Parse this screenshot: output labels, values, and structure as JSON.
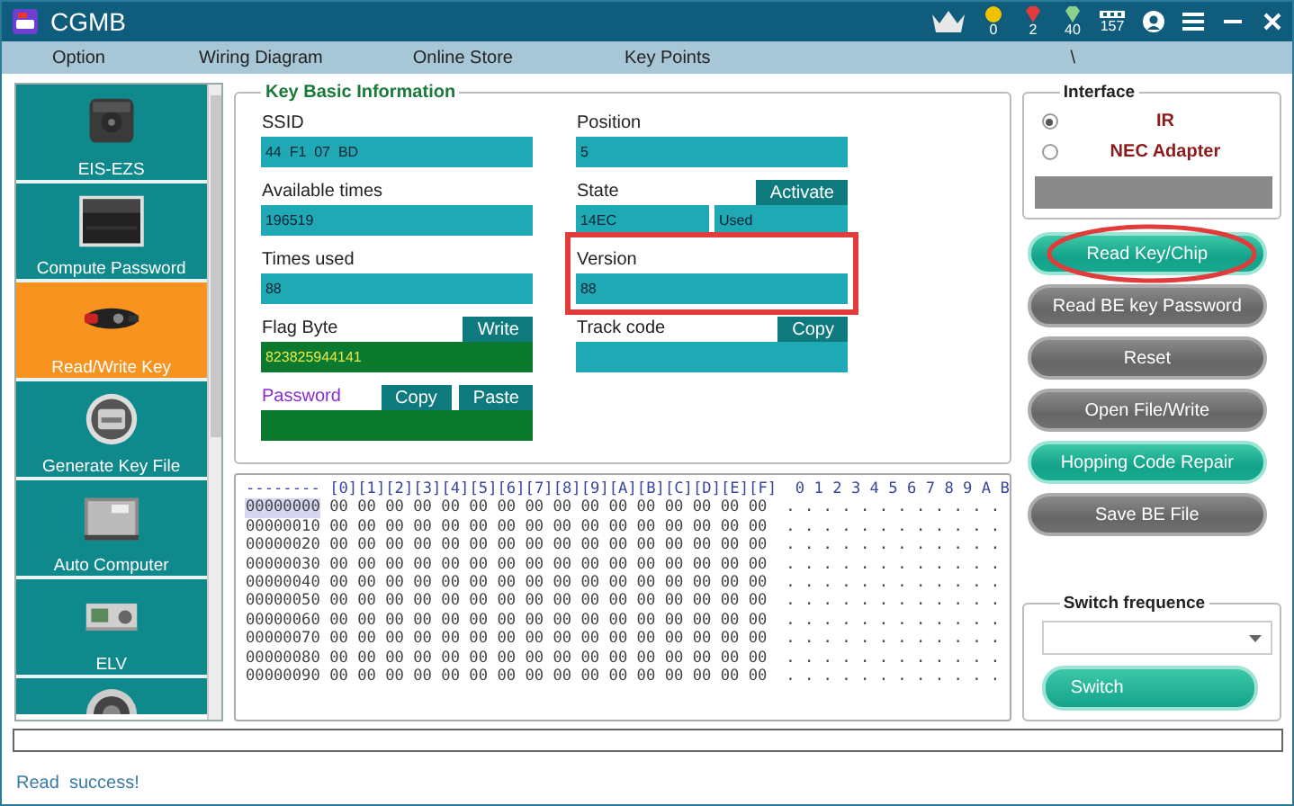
{
  "window": {
    "title": "CGMB"
  },
  "stats": {
    "coins": "0",
    "rubies": "2",
    "diamonds": "40",
    "count": "157"
  },
  "menu": [
    {
      "label": "Option"
    },
    {
      "label": "Wiring Diagram"
    },
    {
      "label": "Online Store"
    },
    {
      "label": "Key Points"
    },
    {
      "label": "\\"
    }
  ],
  "sidebar": {
    "items": [
      {
        "label": "EIS-EZS",
        "selected": false
      },
      {
        "label": "Compute Password",
        "selected": false
      },
      {
        "label": "Read/Write Key",
        "selected": true
      },
      {
        "label": "Generate Key File",
        "selected": false
      },
      {
        "label": "Auto Computer",
        "selected": false
      },
      {
        "label": "ELV",
        "selected": false
      },
      {
        "selected": false
      }
    ]
  },
  "key_info": {
    "title": "Key Basic Information",
    "columns": [
      [
        {
          "label": "SSID",
          "kind": "teal",
          "values": [
            "44  F1  07  BD"
          ]
        },
        {
          "label": "Available times",
          "kind": "teal",
          "values": [
            "196519"
          ]
        },
        {
          "label": "Times used",
          "kind": "teal",
          "values": [
            "88"
          ]
        },
        {
          "label": "Flag Byte",
          "kind": "green",
          "values": [
            "823825944141"
          ],
          "buttons": [
            "Write"
          ]
        },
        {
          "label": "Password",
          "kind": "password",
          "buttons": [
            "Copy",
            "Paste"
          ]
        }
      ],
      [
        {
          "label": "Position",
          "kind": "teal",
          "values": [
            "5"
          ]
        },
        {
          "label": "State",
          "kind": "teal",
          "values": [
            "14EC",
            "Used"
          ],
          "buttons": [
            "Activate"
          ]
        },
        {
          "label": "Version",
          "kind": "teal",
          "values": [
            "88"
          ],
          "highlighted": true
        },
        {
          "label": "Track code",
          "kind": "teal",
          "buttons": [
            "Copy"
          ]
        }
      ]
    ]
  },
  "hex": {
    "header": "--------",
    "columns": [
      "[0]",
      "[1]",
      "[2]",
      "[3]",
      "[4]",
      "[5]",
      "[6]",
      "[7]",
      "[8]",
      "[9]",
      "[A]",
      "[B]",
      "[C]",
      "[D]",
      "[E]",
      "[F]"
    ],
    "ascii_header": "0 1 2 3 4 5 6 7 8 9 A B",
    "rows": [
      {
        "address": "00000000",
        "bytes": "00 00 00 00 00 00 00 00 00 00 00 00 00 00 00 00",
        "ascii": ". . . . . . . . . . . .",
        "selected": true
      },
      {
        "address": "00000010",
        "bytes": "00 00 00 00 00 00 00 00 00 00 00 00 00 00 00 00",
        "ascii": ". . . . . . . . . . . .",
        "selected": false
      },
      {
        "address": "00000020",
        "bytes": "00 00 00 00 00 00 00 00 00 00 00 00 00 00 00 00",
        "ascii": ". . . . . . . . . . . .",
        "selected": false
      },
      {
        "address": "00000030",
        "bytes": "00 00 00 00 00 00 00 00 00 00 00 00 00 00 00 00",
        "ascii": ". . . . . . . . . . . .",
        "selected": false
      },
      {
        "address": "00000040",
        "bytes": "00 00 00 00 00 00 00 00 00 00 00 00 00 00 00 00",
        "ascii": ". . . . . . . . . . . .",
        "selected": false
      },
      {
        "address": "00000050",
        "bytes": "00 00 00 00 00 00 00 00 00 00 00 00 00 00 00 00",
        "ascii": ". . . . . . . . . . . .",
        "selected": false
      },
      {
        "address": "00000060",
        "bytes": "00 00 00 00 00 00 00 00 00 00 00 00 00 00 00 00",
        "ascii": ". . . . . . . . . . . .",
        "selected": false
      },
      {
        "address": "00000070",
        "bytes": "00 00 00 00 00 00 00 00 00 00 00 00 00 00 00 00",
        "ascii": ". . . . . . . . . . . .",
        "selected": false
      },
      {
        "address": "00000080",
        "bytes": "00 00 00 00 00 00 00 00 00 00 00 00 00 00 00 00",
        "ascii": ". . . . . . . . . . . .",
        "selected": false
      },
      {
        "address": "00000090",
        "bytes": "00 00 00 00 00 00 00 00 00 00 00 00 00 00 00 00",
        "ascii": ". . . . . . . . . . . .",
        "selected": false
      }
    ]
  },
  "interface": {
    "title": "Interface",
    "options": [
      {
        "label": "IR",
        "selected": true
      },
      {
        "label": "NEC Adapter",
        "selected": false
      }
    ]
  },
  "actions": [
    {
      "label": "Read Key/Chip",
      "kind": "primary",
      "highlighted": true
    },
    {
      "label": "Read BE key Password",
      "kind": "secondary",
      "highlighted": false
    },
    {
      "label": "Reset",
      "kind": "secondary",
      "highlighted": false
    },
    {
      "label": "Open File/Write",
      "kind": "secondary",
      "highlighted": false
    },
    {
      "label": "Hopping Code Repair",
      "kind": "primary",
      "highlighted": false
    },
    {
      "label": "Save BE File",
      "kind": "secondary",
      "highlighted": false
    }
  ],
  "switch": {
    "title": "Switch frequence",
    "button": "Switch"
  },
  "status": {
    "message": "Read  success!"
  }
}
